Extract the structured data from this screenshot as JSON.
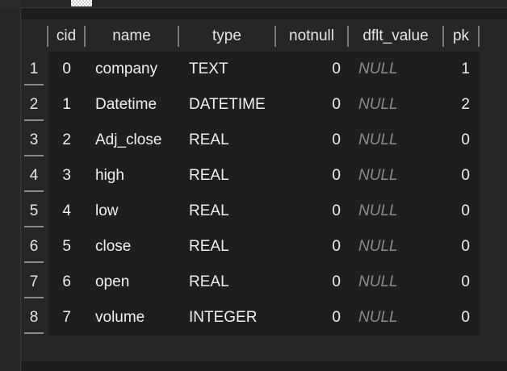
{
  "columns": [
    "cid",
    "name",
    "type",
    "notnull",
    "dflt_value",
    "pk"
  ],
  "rows": [
    {
      "num": "1",
      "cid": "0",
      "name": "company",
      "type": "TEXT",
      "notnull": "0",
      "dflt_value": "NULL",
      "pk": "1"
    },
    {
      "num": "2",
      "cid": "1",
      "name": "Datetime",
      "type": "DATETIME",
      "notnull": "0",
      "dflt_value": "NULL",
      "pk": "2"
    },
    {
      "num": "3",
      "cid": "2",
      "name": "Adj_close",
      "type": "REAL",
      "notnull": "0",
      "dflt_value": "NULL",
      "pk": "0"
    },
    {
      "num": "4",
      "cid": "3",
      "name": "high",
      "type": "REAL",
      "notnull": "0",
      "dflt_value": "NULL",
      "pk": "0"
    },
    {
      "num": "5",
      "cid": "4",
      "name": "low",
      "type": "REAL",
      "notnull": "0",
      "dflt_value": "NULL",
      "pk": "0"
    },
    {
      "num": "6",
      "cid": "5",
      "name": "close",
      "type": "REAL",
      "notnull": "0",
      "dflt_value": "NULL",
      "pk": "0"
    },
    {
      "num": "7",
      "cid": "6",
      "name": "open",
      "type": "REAL",
      "notnull": "0",
      "dflt_value": "NULL",
      "pk": "0"
    },
    {
      "num": "8",
      "cid": "7",
      "name": "volume",
      "type": "INTEGER",
      "notnull": "0",
      "dflt_value": "NULL",
      "pk": "0"
    }
  ],
  "colors": {
    "background": "#1e1e1e",
    "panel": "#262626",
    "text": "#f0f0f0",
    "null_text": "#8c8c8c",
    "separator": "#7a7a7a"
  }
}
